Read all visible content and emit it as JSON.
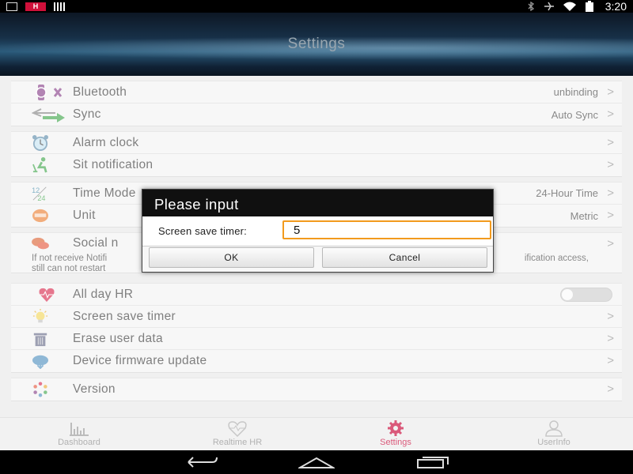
{
  "status_bar": {
    "time": "3:20",
    "badge": "H"
  },
  "header": {
    "title": "Settings"
  },
  "groups": {
    "device": [
      {
        "label": "Bluetooth",
        "value": "unbinding"
      },
      {
        "label": "Sync",
        "value": "Auto Sync"
      }
    ],
    "reminders": [
      {
        "label": "Alarm clock"
      },
      {
        "label": "Sit notification"
      }
    ],
    "units": [
      {
        "label": "Time Mode",
        "value": "24-Hour Time"
      },
      {
        "label": "Unit",
        "value": "Metric"
      }
    ],
    "social": {
      "label": "Social n",
      "desc_line1_left": "If not receive Notifi",
      "desc_line1_right": "ification access,",
      "desc_line2": "still can not restart"
    },
    "misc": [
      {
        "label": "All day HR"
      },
      {
        "label": "Screen save timer"
      },
      {
        "label": "Erase user data"
      },
      {
        "label": "Device firmware update"
      }
    ],
    "version": {
      "label": "Version"
    }
  },
  "tabs": [
    {
      "label": "Dashboard"
    },
    {
      "label": "Realtime HR"
    },
    {
      "label": "Settings"
    },
    {
      "label": "UserInfo"
    }
  ],
  "dialog": {
    "title": "Please input",
    "field_label": "Screen save timer:",
    "field_value": "5",
    "ok_label": "OK",
    "cancel_label": "Cancel"
  },
  "colors": {
    "accent": "#c70033",
    "input_focus": "#f29a1d",
    "icon_purple": "#7b2c7d",
    "icon_green": "#2e9e3a"
  }
}
